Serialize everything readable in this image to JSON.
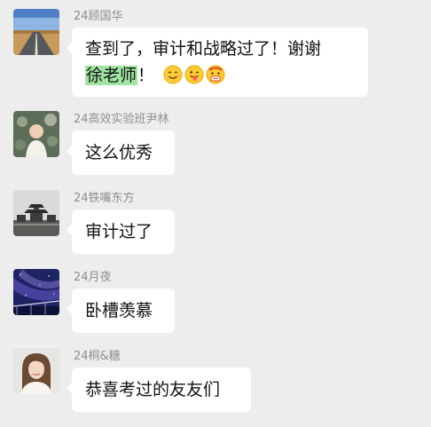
{
  "messages": [
    {
      "sender": "24顾国华",
      "avatar_icon": "road-landscape-avatar-icon",
      "text_lines": [
        "查到了，审计和战略过了！谢谢",
        "徐老师",
        "！"
      ],
      "emojis": [
        "smiling-face-icon",
        "winking-tongue-face-icon",
        "money-mouth-face-icon"
      ]
    },
    {
      "sender": "24高效实验班尹林",
      "avatar_icon": "child-photo-avatar-icon",
      "text": "这么优秀"
    },
    {
      "sender": "24铁嘴东方",
      "avatar_icon": "pagoda-landscape-avatar-icon",
      "text": "审计过了"
    },
    {
      "sender": "24月夜",
      "avatar_icon": "night-sky-avatar-icon",
      "text": "卧槽羡慕"
    },
    {
      "sender": "24桐&糖",
      "avatar_icon": "woman-portrait-avatar-icon",
      "text": "恭喜考过的友友们"
    }
  ],
  "colors": {
    "background": "#ededed",
    "bubble": "#ffffff",
    "highlight": "#9fe5a1",
    "sender_name": "#8f8f8f"
  }
}
